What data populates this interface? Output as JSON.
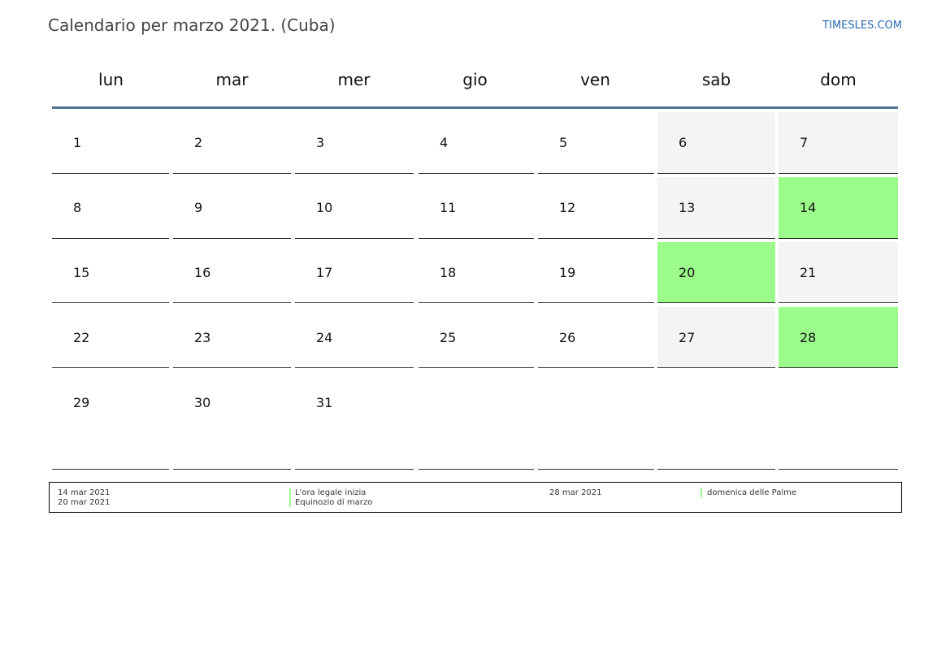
{
  "header": {
    "title": "Calendario per marzo 2021. (Cuba)",
    "site": "TIMESLES.COM"
  },
  "weekdays": [
    "lun",
    "mar",
    "mer",
    "gio",
    "ven",
    "sab",
    "dom"
  ],
  "weeks": [
    [
      {
        "d": "1",
        "t": "n"
      },
      {
        "d": "2",
        "t": "n"
      },
      {
        "d": "3",
        "t": "n"
      },
      {
        "d": "4",
        "t": "n"
      },
      {
        "d": "5",
        "t": "n"
      },
      {
        "d": "6",
        "t": "w"
      },
      {
        "d": "7",
        "t": "w"
      }
    ],
    [
      {
        "d": "8",
        "t": "n"
      },
      {
        "d": "9",
        "t": "n"
      },
      {
        "d": "10",
        "t": "n"
      },
      {
        "d": "11",
        "t": "n"
      },
      {
        "d": "12",
        "t": "n"
      },
      {
        "d": "13",
        "t": "w"
      },
      {
        "d": "14",
        "t": "h"
      }
    ],
    [
      {
        "d": "15",
        "t": "n"
      },
      {
        "d": "16",
        "t": "n"
      },
      {
        "d": "17",
        "t": "n"
      },
      {
        "d": "18",
        "t": "n"
      },
      {
        "d": "19",
        "t": "n"
      },
      {
        "d": "20",
        "t": "h"
      },
      {
        "d": "21",
        "t": "w"
      }
    ],
    [
      {
        "d": "22",
        "t": "n"
      },
      {
        "d": "23",
        "t": "n"
      },
      {
        "d": "24",
        "t": "n"
      },
      {
        "d": "25",
        "t": "n"
      },
      {
        "d": "26",
        "t": "n"
      },
      {
        "d": "27",
        "t": "w"
      },
      {
        "d": "28",
        "t": "h"
      }
    ],
    [
      {
        "d": "29",
        "t": "n"
      },
      {
        "d": "30",
        "t": "n"
      },
      {
        "d": "31",
        "t": "n"
      },
      {
        "d": "",
        "t": "e"
      },
      {
        "d": "",
        "t": "e"
      },
      {
        "d": "",
        "t": "e"
      },
      {
        "d": "",
        "t": "e"
      }
    ]
  ],
  "legend": [
    {
      "date": "14 mar 2021",
      "event": "L'ora legale inizia"
    },
    {
      "date": "20 mar 2021",
      "event": "Equinozio di marzo"
    },
    {
      "date": "28 mar 2021",
      "event": "domenica delle Palme"
    }
  ],
  "colors": {
    "holiday": "#9bfc8b",
    "weekend": "#f4f4f4",
    "header_rule": "#557396",
    "site_link": "#2a6bb5"
  }
}
